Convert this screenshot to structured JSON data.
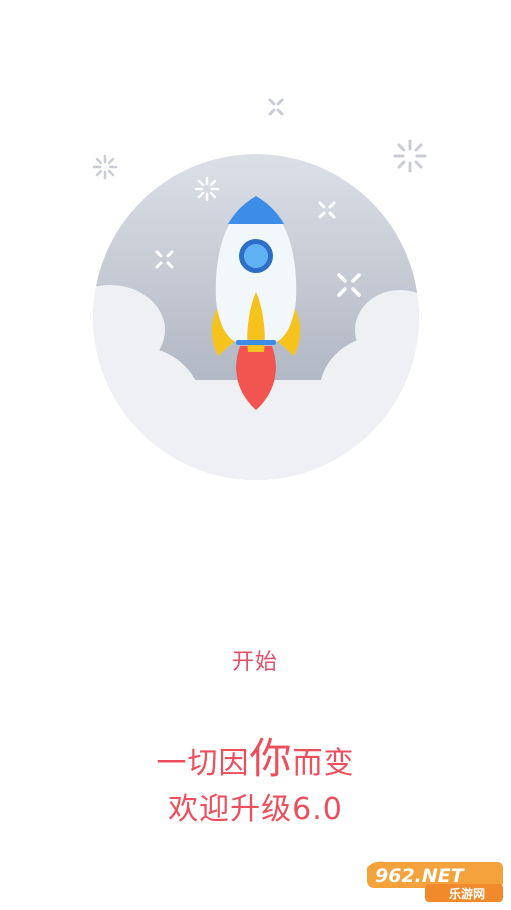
{
  "start_button": {
    "label": "开始"
  },
  "slogan": {
    "line1_before": "一切因",
    "line1_big": "你",
    "line1_after": "而变",
    "line2": "欢迎升级6.0"
  },
  "watermark": {
    "logo_text": "962.NET",
    "site_text": "乐游网"
  },
  "colors": {
    "accent": "#e0506a",
    "slogan": "#ee4e5c",
    "rocket_body": "#f2f7fb",
    "rocket_nose": "#3b8de8",
    "rocket_fins": "#f6c21d",
    "flame": "#f2544f"
  },
  "icons": [
    "rocket-icon",
    "cloud-icon",
    "sparkle-icon",
    "star-cross-icon"
  ]
}
